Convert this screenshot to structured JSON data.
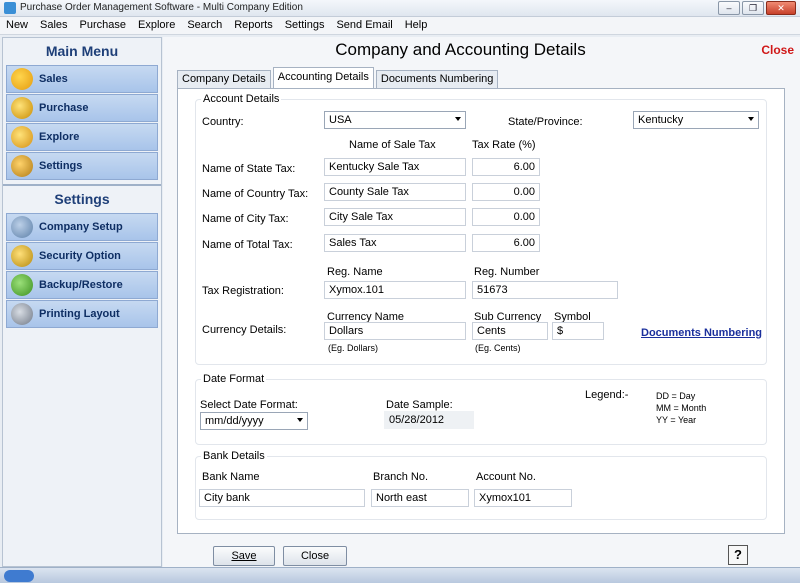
{
  "window": {
    "title": "Purchase Order Management Software - Multi Company Edition"
  },
  "menubar": [
    "New",
    "Sales",
    "Purchase",
    "Explore",
    "Search",
    "Reports",
    "Settings",
    "Send Email",
    "Help"
  ],
  "sidebar": {
    "main_menu_title": "Main Menu",
    "main_items": [
      {
        "label": "Sales",
        "icon": "chart-icon"
      },
      {
        "label": "Purchase",
        "icon": "coins-icon"
      },
      {
        "label": "Explore",
        "icon": "explore-icon"
      },
      {
        "label": "Settings",
        "icon": "gear-icon"
      }
    ],
    "settings_title": "Settings",
    "settings_items": [
      {
        "label": "Company Setup",
        "icon": "company-icon"
      },
      {
        "label": "Security Option",
        "icon": "lock-icon"
      },
      {
        "label": "Backup/Restore",
        "icon": "backup-icon"
      },
      {
        "label": "Printing Layout",
        "icon": "printer-icon"
      }
    ]
  },
  "header": {
    "title": "Company and Accounting Details",
    "close_label": "Close"
  },
  "tabs": [
    {
      "label": "Company Details",
      "active": false
    },
    {
      "label": "Accounting Details",
      "active": true
    },
    {
      "label": "Documents Numbering",
      "active": false
    }
  ],
  "account": {
    "group_title": "Account Details",
    "country_label": "Country:",
    "country_value": "USA",
    "state_label": "State/Province:",
    "state_value": "Kentucky",
    "col_name_header": "Name of Sale Tax",
    "col_rate_header": "Tax Rate (%)",
    "taxes": [
      {
        "label": "Name of State Tax:",
        "name": "Kentucky Sale Tax",
        "rate": "6.00"
      },
      {
        "label": "Name of Country Tax:",
        "name": "County Sale Tax",
        "rate": "0.00"
      },
      {
        "label": "Name of City Tax:",
        "name": "City Sale Tax",
        "rate": "0.00"
      },
      {
        "label": "Name of Total Tax:",
        "name": "Sales Tax",
        "rate": "6.00"
      }
    ],
    "reg_label": "Tax Registration:",
    "reg_name_header": "Reg. Name",
    "reg_number_header": "Reg. Number",
    "reg_name": "Xymox.101",
    "reg_number": "51673",
    "currency_label": "Currency Details:",
    "currency_name_header": "Currency Name",
    "sub_currency_header": "Sub Currency",
    "symbol_header": "Symbol",
    "currency_name": "Dollars",
    "sub_currency": "Cents",
    "symbol": "$",
    "currency_hint": "(Eg. Dollars)",
    "sub_hint": "(Eg. Cents)",
    "doc_link": "Documents Numbering"
  },
  "date": {
    "group_title": "Date Format",
    "select_label": "Select Date Format:",
    "format_value": "mm/dd/yyyy",
    "sample_label": "Date Sample:",
    "sample_value": "05/28/2012",
    "legend_label": "Legend:-",
    "legend": [
      "DD = Day",
      "MM = Month",
      "YY = Year"
    ]
  },
  "bank": {
    "group_title": "Bank Details",
    "name_label": "Bank Name",
    "branch_label": "Branch No.",
    "account_label": "Account No.",
    "name_value": "City bank",
    "branch_value": "North east",
    "account_value": "Xymox101"
  },
  "footer": {
    "save_label": "Save",
    "close_label": "Close",
    "help_label": "?"
  },
  "colors": {
    "close_red": "#d01818",
    "link_blue": "#1a2f9c",
    "sidebar_blue": "#a8c4ea"
  }
}
